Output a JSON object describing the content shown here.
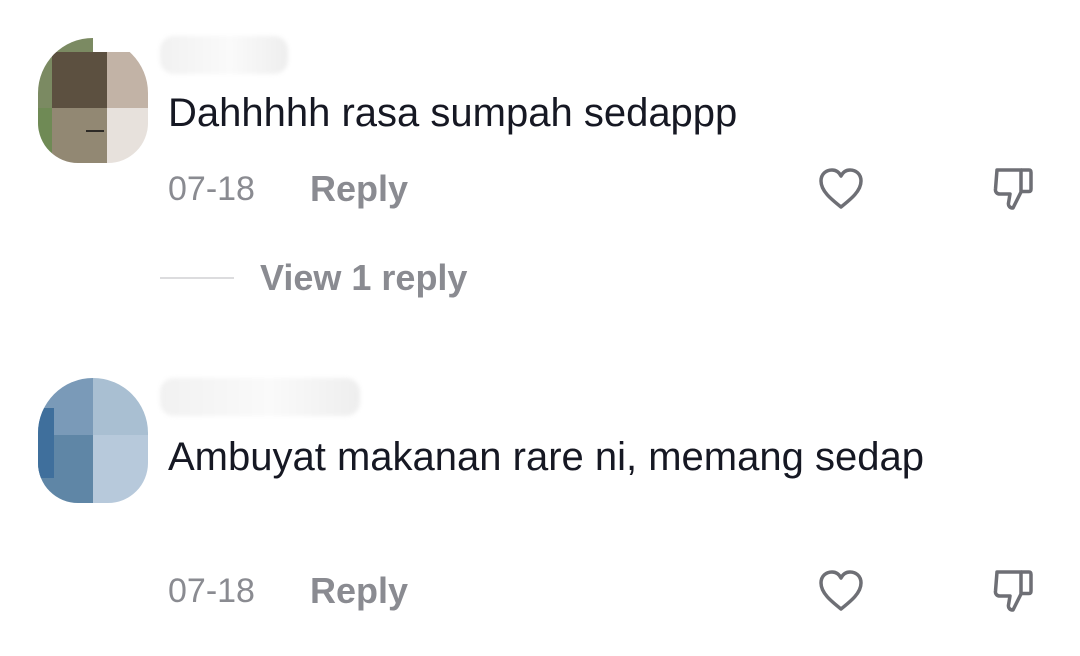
{
  "comments": [
    {
      "username_partial": "",
      "text": "Dahhhhh rasa sumpah sedappp",
      "date": "07-18",
      "reply_label": "Reply",
      "view_replies_label": "View 1 reply",
      "like_icon": "heart-outline-icon",
      "dislike_icon": "thumbs-down-outline-icon"
    },
    {
      "username_partial": "",
      "text": "Ambuyat makanan rare ni, memang sedap",
      "date": "07-18",
      "reply_label": "Reply",
      "like_icon": "heart-outline-icon",
      "dislike_icon": "thumbs-down-outline-icon"
    }
  ],
  "colors": {
    "text_primary": "#161823",
    "text_secondary": "#8a8b91",
    "divider": "#dcdcde",
    "background": "#ffffff"
  }
}
